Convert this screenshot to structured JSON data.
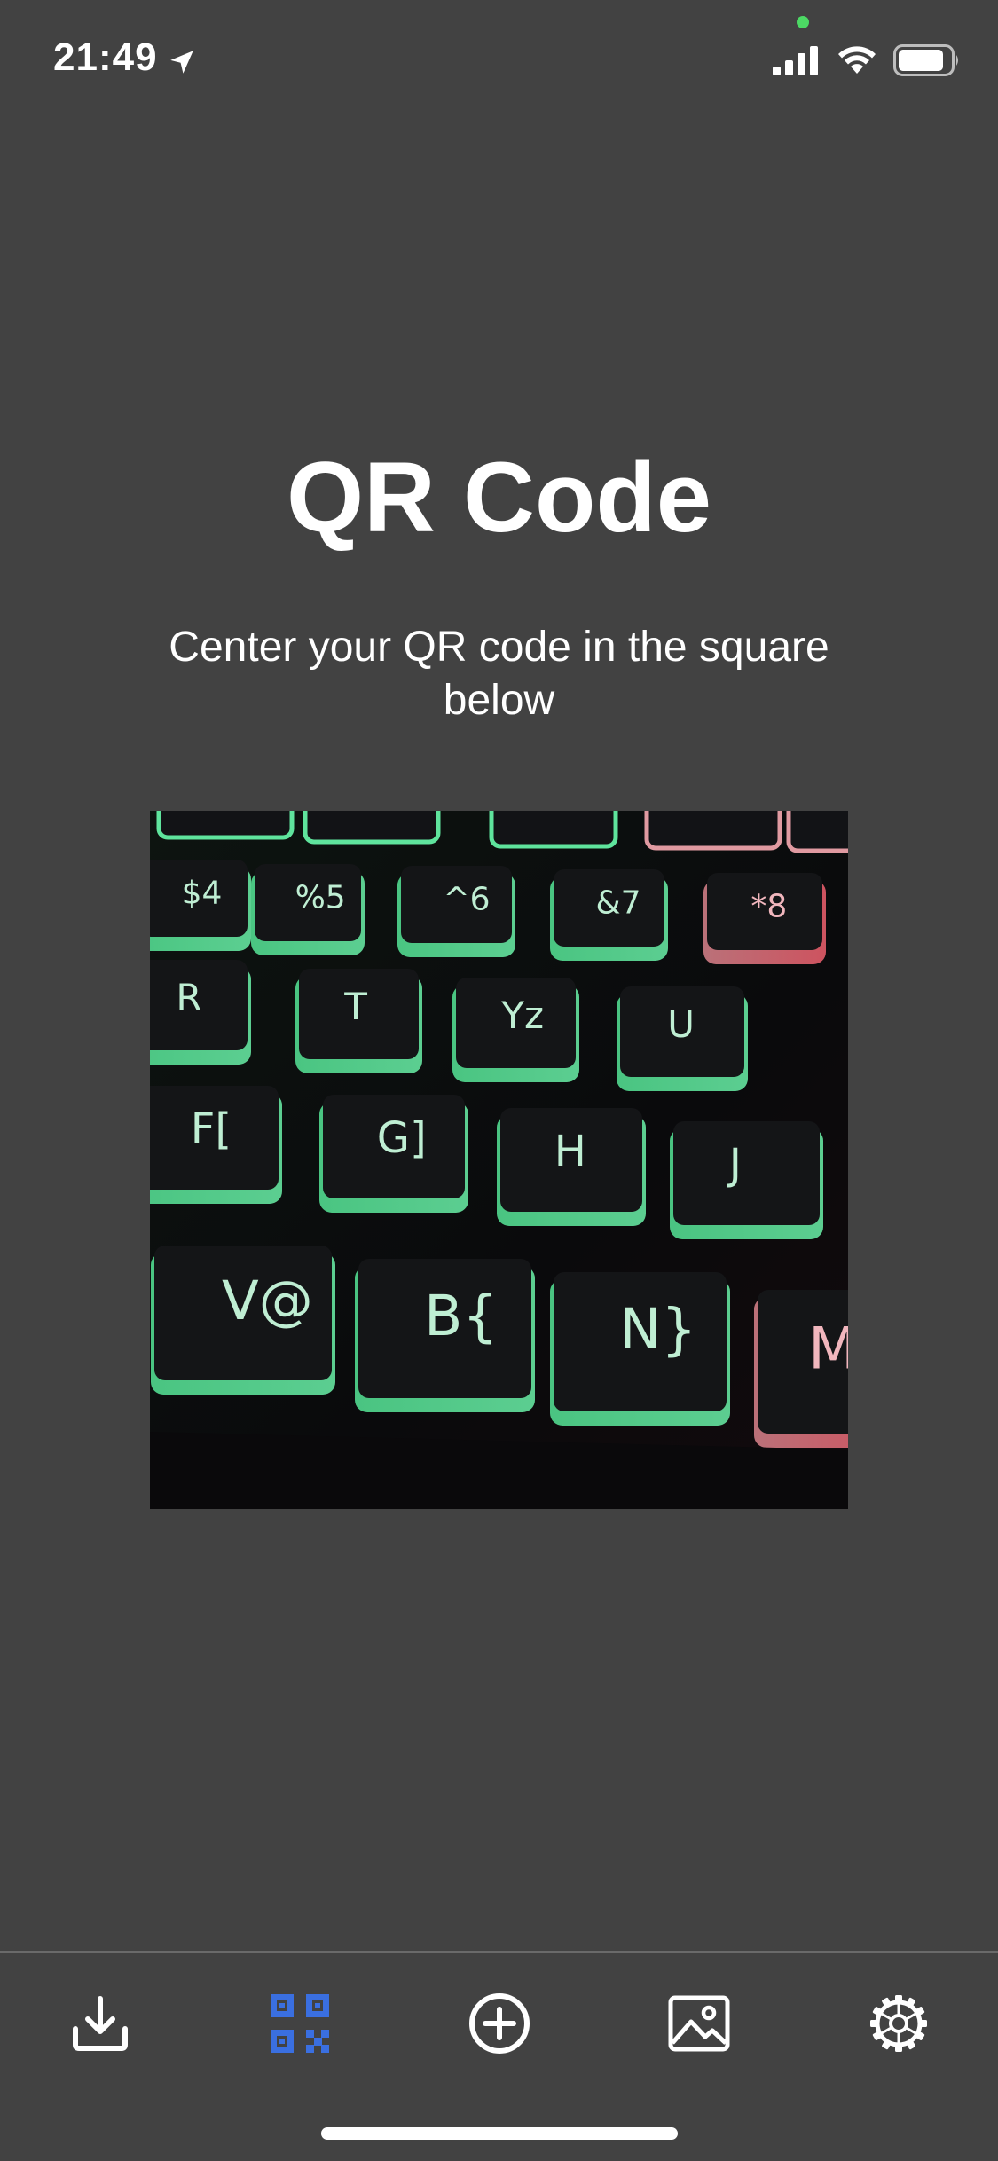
{
  "status_bar": {
    "time": "21:49",
    "location_icon": "location-arrow-icon",
    "mic_dot_color": "#4cd964",
    "signal_icon": "cellular-signal-icon",
    "wifi_icon": "wifi-icon",
    "battery_icon": "battery-icon"
  },
  "main": {
    "title": "QR Code",
    "instruction": "Center your QR code in the square below",
    "camera_preview": {
      "description_icon": "camera-viewfinder",
      "keys": [
        "R",
        "T",
        "Yz",
        "U",
        "F[",
        "G]",
        "H",
        "J",
        "V@",
        "B{",
        "N}",
        "M",
        "$4",
        "%5",
        "^6",
        "&7",
        "*8"
      ]
    }
  },
  "tab_bar": {
    "active_color": "#3a6fe0",
    "inactive_color": "#ffffff",
    "items": [
      {
        "icon": "download-icon",
        "active": false
      },
      {
        "icon": "qr-code-icon",
        "active": true
      },
      {
        "icon": "add-circle-icon",
        "active": false
      },
      {
        "icon": "image-icon",
        "active": false
      },
      {
        "icon": "gear-icon",
        "active": false
      }
    ]
  }
}
